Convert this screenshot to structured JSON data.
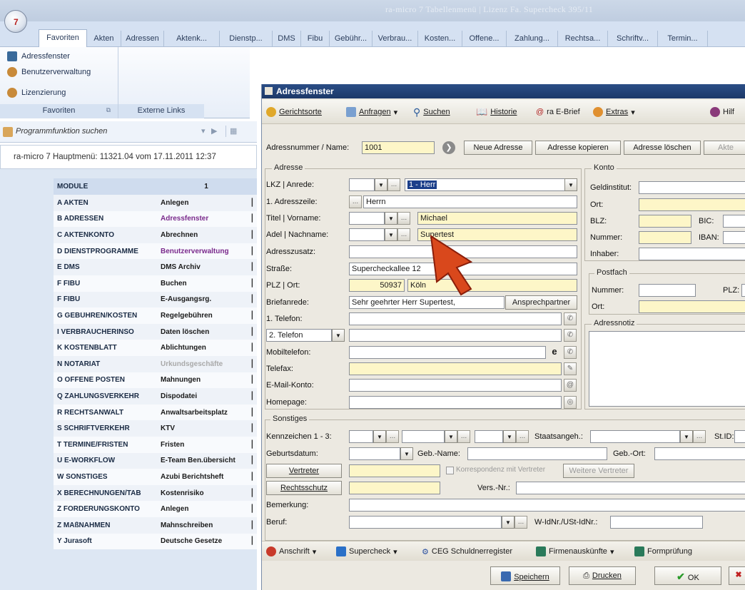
{
  "app": {
    "title": "ra-micro 7 Tabellenmenü | Lizenz Fa. Supercheck 395/11",
    "orb_label": "7"
  },
  "tabs": [
    "Favoriten",
    "Akten",
    "Adressen",
    "Aktenk...",
    "Dienstp...",
    "DMS",
    "Fibu",
    "Gebühr...",
    "Verbrau...",
    "Kosten...",
    "Offene...",
    "Zahlung...",
    "Rechtsa...",
    "Schriftv...",
    "Termin..."
  ],
  "ribbon": {
    "items": [
      "Adressfenster",
      "Benutzerverwaltung",
      "Lizenzierung"
    ],
    "group_favoriten": "Favoriten",
    "group_externe": "Externe Links"
  },
  "search": {
    "placeholder": "Programmfunktion suchen"
  },
  "main_menu": {
    "text": "ra-micro 7 Hauptmenü: 11321.04 vom 17.11.2011 12:37"
  },
  "menu_table": {
    "header_modules": "MODULE",
    "header_col1": "1",
    "rows": [
      {
        "module": "A AKTEN",
        "function": "Anlegen"
      },
      {
        "module": "B ADRESSEN",
        "function": "Adressfenster"
      },
      {
        "module": "C AKTENKONTO",
        "function": "Abrechnen"
      },
      {
        "module": "D DIENSTPROGRAMME",
        "function": "Benutzerverwaltung"
      },
      {
        "module": "E DMS",
        "function": "DMS Archiv"
      },
      {
        "module": "F FIBU",
        "function": "Buchen"
      },
      {
        "module": "F FIBU",
        "function": "E-Ausgangsrg."
      },
      {
        "module": "G GEBÜHREN/KOSTEN",
        "function": "Regelgebühren"
      },
      {
        "module": "I VERBRAUCHERINSO",
        "function": "Daten löschen"
      },
      {
        "module": "K KOSTENBLATT",
        "function": "Ablichtungen"
      },
      {
        "module": "N NOTARIAT",
        "function": "Urkundsgeschäfte"
      },
      {
        "module": "O OFFENE POSTEN",
        "function": "Mahnungen"
      },
      {
        "module": "Q ZAHLUNGSVERKEHR",
        "function": "Dispodatei"
      },
      {
        "module": "R RECHTSANWALT",
        "function": "Anwaltsarbeitsplatz"
      },
      {
        "module": "S SCHRIFTVERKEHR",
        "function": "KTV"
      },
      {
        "module": "T TERMINE/FRISTEN",
        "function": "Fristen"
      },
      {
        "module": "U E-WORKFLOW",
        "function": "E-Team Ben.übersicht"
      },
      {
        "module": "W SONSTIGES",
        "function": "Azubi Berichtsheft"
      },
      {
        "module": "X BERECHNUNGEN/TAB",
        "function": "Kostenrisiko"
      },
      {
        "module": "Z FORDERUNGSKONTO",
        "function": "Anlegen"
      },
      {
        "module": "Z MAßNAHMEN",
        "function": "Mahnschreiben"
      },
      {
        "module": "Y Jurasoft",
        "function": "Deutsche Gesetze"
      }
    ]
  },
  "dialog": {
    "title": "Adressfenster",
    "toolbar": {
      "gerichtsorte": "Gerichtsorte",
      "anfragen": "Anfragen",
      "suchen": "Suchen",
      "historie": "Historie",
      "ebrief": "ra E-Brief",
      "extras": "Extras",
      "hilfe": "Hilf"
    },
    "adressnummer_label": "Adressnummer / Name:",
    "adressnummer_value": "1001",
    "btn_neue": "Neue Adresse",
    "btn_kopieren": "Adresse kopieren",
    "btn_loeschen": "Adresse löschen",
    "btn_akte": "Akte",
    "adresse": {
      "legend": "Adresse",
      "lkz_label": "LKZ | Anrede:",
      "anrede_value": "1 - Herr",
      "adresszeile_label": "1. Adresszeile:",
      "adresszeile_value": "Herrn",
      "titel_label": "Titel | Vorname:",
      "vorname_value": "Michael",
      "adel_label": "Adel | Nachname:",
      "nachname_value": "Supertest",
      "zusatz_label": "Adresszusatz:",
      "strasse_label": "Straße:",
      "strasse_value": "Supercheckallee 12",
      "plz_label": "PLZ | Ort:",
      "plz_value": "50937",
      "ort_value": "Köln",
      "briefanrede_label": "Briefanrede:",
      "briefanrede_value": "Sehr geehrter Herr Supertest,",
      "ansprechpartner_btn": "Ansprechpartner",
      "tel1_label": "1. Telefon:",
      "tel2_value": "2. Telefon",
      "mobil_label": "Mobiltelefon:",
      "telefax_label": "Telefax:",
      "email_label": "E-Mail-Konto:",
      "homepage_label": "Homepage:"
    },
    "konto": {
      "legend": "Konto",
      "geldinstitut": "Geldinstitut:",
      "ort": "Ort:",
      "blz": "BLZ:",
      "bic": "BIC:",
      "nummer": "Nummer:",
      "iban": "IBAN:",
      "inhaber": "Inhaber:"
    },
    "postfach": {
      "legend": "Postfach",
      "nummer": "Nummer:",
      "plz": "PLZ:",
      "ort": "Ort:"
    },
    "adressnotiz": {
      "legend": "Adressnotiz"
    },
    "sonstiges": {
      "legend": "Sonstiges",
      "kennzeichen": "Kennzeichen 1 - 3:",
      "staatsangeh": "Staatsangeh.:",
      "stid": "St.ID:",
      "geburtsdatum": "Geburtsdatum:",
      "gebname": "Geb.-Name:",
      "gebort": "Geb.-Ort:",
      "vertreter_btn": "Vertreter",
      "korrespondenz": "Korrespondenz mit Vertreter",
      "weitere_btn": "Weitere Vertreter",
      "rechtsschutz_btn": "Rechtsschutz",
      "versnr": "Vers.-Nr.:",
      "bemerkung": "Bemerkung:",
      "beruf": "Beruf:",
      "wid": "W-IdNr./USt-IdNr.:"
    },
    "bottom": {
      "anschrift": "Anschrift",
      "supercheck": "Supercheck",
      "ceg": "CEG Schuldnerregister",
      "firmen": "Firmenauskünfte",
      "formpruefung": "Formprüfung"
    },
    "footer": {
      "speichern": "Speichern",
      "drucken": "Drucken",
      "ok": "OK"
    }
  },
  "colors": {
    "accent": "#1c3868",
    "highlight_row_text": "#7a2a8c",
    "cursor_arrow": "#d9481c"
  }
}
